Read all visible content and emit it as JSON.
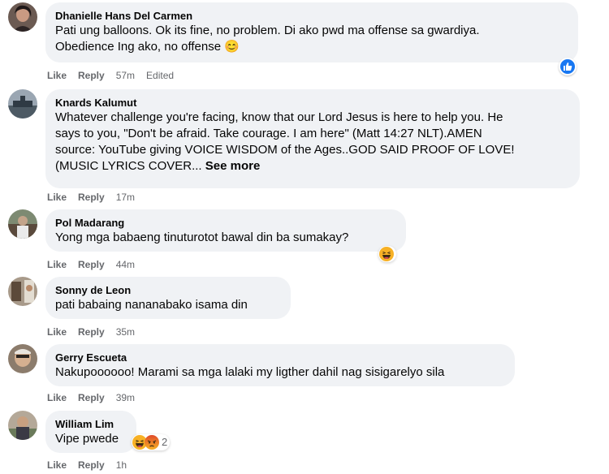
{
  "actions": {
    "like": "Like",
    "reply": "Reply"
  },
  "comments": [
    {
      "author": "Dhanielle Hans Del Carmen",
      "lines": [
        "Pati ung balloons. Ok its fine, no problem. Di ako pwd ma offense sa gwardiya.",
        "Obedience Ing ako, no offense 😊"
      ],
      "time": "57m",
      "edited": "Edited",
      "reactions": [
        "like"
      ]
    },
    {
      "author": "Knards Kalumut",
      "lines": [
        "Whatever challenge you're facing, know that our Lord Jesus is here to help you. He",
        "says to you, \"Don't be afraid. Take courage. I am here\" (Matt 14:27 NLT).AMEN",
        "source: YouTube giving VOICE WISDOM of the Ages..GOD SAID PROOF OF LOVE!",
        "(MUSIC LYRICS COVER..."
      ],
      "see_more": "See more",
      "time": "17m"
    },
    {
      "author": "Pol Madarang",
      "lines": [
        "Yong mga babaeng tinuturotot bawal din ba sumakay?"
      ],
      "time": "44m",
      "reactions": [
        "haha"
      ]
    },
    {
      "author": "Sonny de Leon",
      "lines": [
        "pati babaing nananabako isama din"
      ],
      "time": "35m"
    },
    {
      "author": "Gerry Escueta",
      "lines": [
        "Nakupoooooo! Marami sa mga lalaki my ligther dahil nag sisigarelyo sila"
      ],
      "time": "39m"
    },
    {
      "author": "William Lim",
      "lines": [
        "Vipe pwede"
      ],
      "time": "1h",
      "reactions": [
        "haha",
        "angry"
      ],
      "reaction_count": "2"
    }
  ],
  "colors": {
    "bubble": "#f0f2f5",
    "meta": "#65676b",
    "like_blue": "#1877f2",
    "haha_yellow": "#f7b125",
    "angry_red": "#e9710f"
  },
  "icons": [
    "thumbs-up-icon",
    "haha-emoji-icon",
    "angry-emoji-icon",
    "smile-emoji-icon"
  ]
}
